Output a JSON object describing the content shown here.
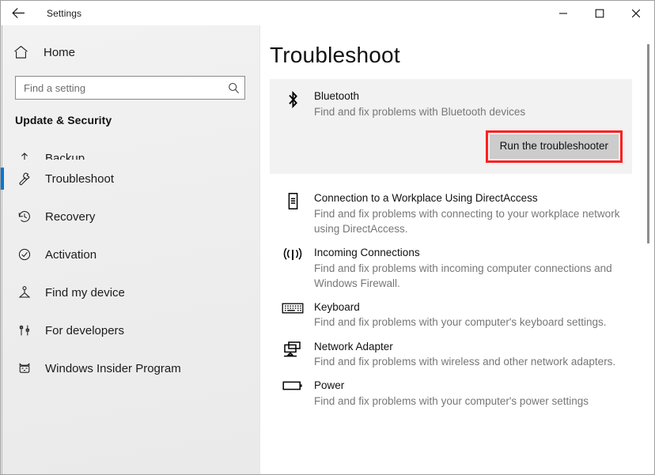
{
  "window": {
    "title": "Settings",
    "back_icon": "back-arrow-icon",
    "minimize_label": "Minimize",
    "maximize_label": "Maximize",
    "close_label": "Close"
  },
  "accent_color": "#0078d7",
  "annotation_color": "#ff1f1f",
  "sidebar": {
    "home_label": "Home",
    "home_icon": "home-icon",
    "search": {
      "placeholder": "Find a setting",
      "value": "",
      "icon": "search-icon"
    },
    "group_title": "Update & Security",
    "items": [
      {
        "label": "Backup",
        "icon": "backup-icon",
        "selected": false,
        "clipped": true
      },
      {
        "label": "Troubleshoot",
        "icon": "wrench-icon",
        "selected": true,
        "clipped": false
      },
      {
        "label": "Recovery",
        "icon": "history-clock-icon",
        "selected": false,
        "clipped": false
      },
      {
        "label": "Activation",
        "icon": "check-circle-icon",
        "selected": false,
        "clipped": false
      },
      {
        "label": "Find my device",
        "icon": "locate-device-icon",
        "selected": false,
        "clipped": false
      },
      {
        "label": "For developers",
        "icon": "developer-tools-icon",
        "selected": false,
        "clipped": false
      },
      {
        "label": "Windows Insider Program",
        "icon": "ninja-cat-icon",
        "selected": false,
        "clipped": false
      }
    ]
  },
  "main": {
    "page_title": "Troubleshoot",
    "featured": {
      "name": "Bluetooth",
      "description": "Find and fix problems with Bluetooth devices",
      "icon": "bluetooth-icon",
      "button_label": "Run the troubleshooter",
      "highlighted": true
    },
    "troubleshooters": [
      {
        "name": "Connection to a Workplace Using DirectAccess",
        "description": "Find and fix problems with connecting to your workplace network using DirectAccess.",
        "icon": "server-tower-icon"
      },
      {
        "name": "Incoming Connections",
        "description": "Find and fix problems with incoming computer connections and Windows Firewall.",
        "icon": "broadcast-antenna-icon"
      },
      {
        "name": "Keyboard",
        "description": "Find and fix problems with your computer's keyboard settings.",
        "icon": "keyboard-icon"
      },
      {
        "name": "Network Adapter",
        "description": "Find and fix problems with wireless and other network adapters.",
        "icon": "network-adapter-icon"
      },
      {
        "name": "Power",
        "description": "Find and fix problems with your computer's power settings",
        "icon": "battery-icon"
      }
    ]
  }
}
